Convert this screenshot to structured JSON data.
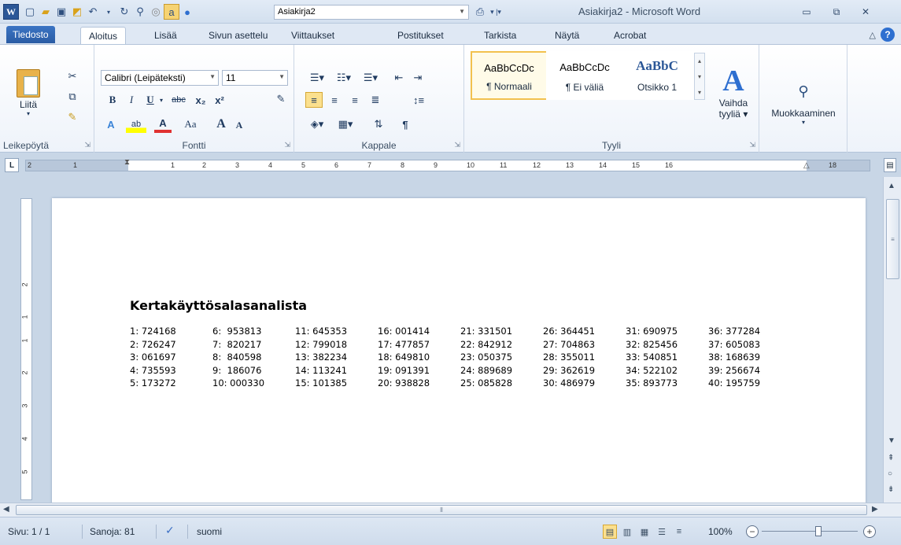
{
  "titlebar": {
    "app_icon": "W",
    "font_box_value": "Asiakirja2",
    "window_title": "Asiakirja2 - Microsoft Word"
  },
  "tabs": [
    "Tiedosto",
    "Aloitus",
    "Lisää",
    "Sivun asettelu",
    "Viittaukset",
    "Postitukset",
    "Tarkista",
    "Näytä",
    "Acrobat"
  ],
  "ribbon": {
    "clipboard": {
      "label": "Leikepöytä",
      "paste_label": "Liitä"
    },
    "font": {
      "label": "Fontti",
      "font_name": "Calibri (Leipäteksti)",
      "font_size": "11",
      "bold": "B",
      "italic": "I",
      "underline": "U",
      "strike": "abc",
      "subscript": "x₂",
      "superscript": "x²",
      "change_case": "Aa",
      "grow": "A",
      "shrink": "A"
    },
    "paragraph": {
      "label": "Kappale"
    },
    "styles": {
      "label": "Tyyli",
      "items": [
        {
          "sample": "AaBbCcDc",
          "name": "¶ Normaali"
        },
        {
          "sample": "AaBbCcDc",
          "name": "¶ Ei väliä"
        },
        {
          "sample": "AaBbC",
          "name": "Otsikko 1"
        }
      ],
      "change_styles": "Vaihda tyyliä",
      "change_styles_line1": "Vaihda",
      "change_styles_line2": "tyyliä ▾"
    },
    "editing": {
      "label": "Muokkaaminen"
    }
  },
  "ruler": {
    "h_numbers": [
      "2",
      "1",
      "1",
      "2",
      "3",
      "4",
      "5",
      "6",
      "7",
      "8",
      "9",
      "10",
      "11",
      "12",
      "13",
      "14",
      "15",
      "16",
      "18"
    ],
    "v_numbers": [
      "2",
      "1",
      "1",
      "2",
      "3",
      "4",
      "5"
    ]
  },
  "document": {
    "heading": "Kertakäyttösalasanalista",
    "columns": [
      [
        "1: 724168",
        "2: 726247",
        "3: 061697",
        "4: 735593",
        "5: 173272"
      ],
      [
        "6:  953813",
        "7:  820217",
        "8:  840598",
        "9:  186076",
        "10: 000330"
      ],
      [
        "11: 645353",
        "12: 799018",
        "13: 382234",
        "14: 113241",
        "15: 101385"
      ],
      [
        "16: 001414",
        "17: 477857",
        "18: 649810",
        "19: 091391",
        "20: 938828"
      ],
      [
        "21: 331501",
        "22: 842912",
        "23: 050375",
        "24: 889689",
        "25: 085828"
      ],
      [
        "26: 364451",
        "27: 704863",
        "28: 355011",
        "29: 362619",
        "30: 486979"
      ],
      [
        "31: 690975",
        "32: 825456",
        "33: 540851",
        "34: 522102",
        "35: 893773"
      ],
      [
        "36: 377284",
        "37: 605083",
        "38: 168639",
        "39: 256674",
        "40: 195759"
      ]
    ]
  },
  "statusbar": {
    "page": "Sivu: 1 / 1",
    "words": "Sanoja: 81",
    "language": "suomi",
    "zoom": "100%",
    "zoom_minus": "−",
    "zoom_plus": "+"
  },
  "colors": {
    "accent": "#2b5797",
    "file_tab": "#2a5ca4",
    "style_highlight": "#f2c14e"
  }
}
